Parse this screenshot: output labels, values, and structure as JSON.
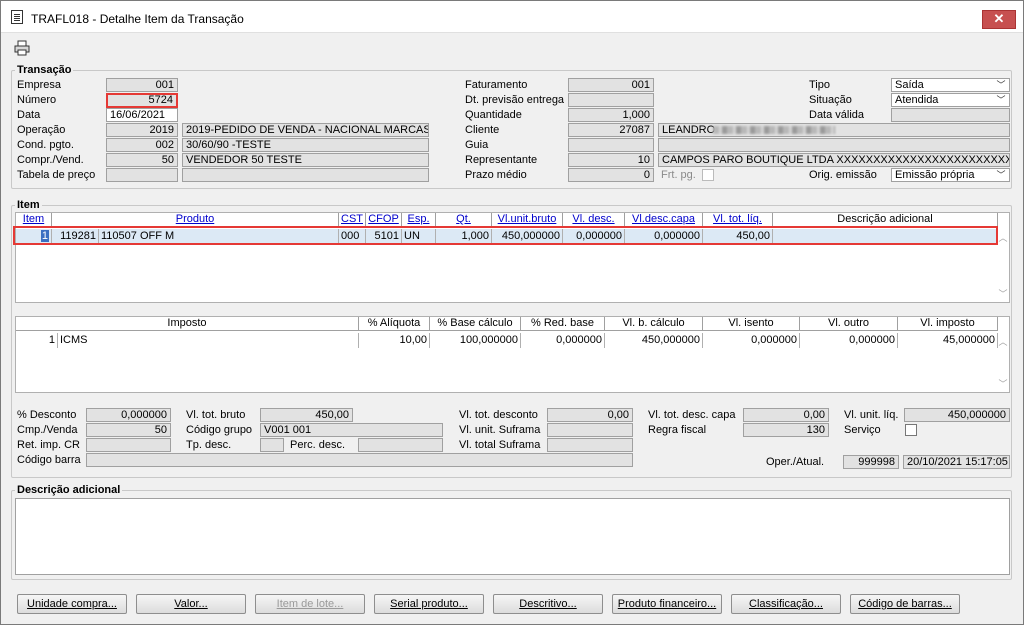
{
  "window": {
    "title": "TRAFL018 - Detalhe Item da Transação",
    "close": "✕"
  },
  "transacao": {
    "title": "Transação",
    "empresa_label": "Empresa",
    "empresa": "001",
    "numero_label": "Número",
    "numero": "5724",
    "data_label": "Data",
    "data": "16/06/2021",
    "operacao_label": "Operação",
    "operacao_code": "2019",
    "operacao_desc": "2019-PEDIDO DE VENDA - NACIONAL MARCAS",
    "cond_label": "Cond. pgto.",
    "cond_code": "002",
    "cond_desc": "30/60/90 -TESTE",
    "compr_label": "Compr./Vend.",
    "compr_code": "50",
    "compr_desc": "VENDEDOR 50 TESTE",
    "tabela_label": "Tabela de preço",
    "tabela_code": "",
    "tabela_desc": "",
    "faturamento_label": "Faturamento",
    "faturamento": "001",
    "dtprev_label": "Dt. previsão entrega",
    "dtprev": "",
    "quantidade_label": "Quantidade",
    "quantidade": "1,000",
    "cliente_label": "Cliente",
    "cliente_code": "27087",
    "cliente_name": "LEANDRO",
    "guia_label": "Guia",
    "guia": "",
    "representante_label": "Representante",
    "representante_code": "10",
    "representante_name": "CAMPOS PARO BOUTIQUE LTDA XXXXXXXXXXXXXXXXXXXXXXXXXXXX",
    "prazo_label": "Prazo médio",
    "prazo": "0",
    "frt_label": "Frt. pg.",
    "tipo_label": "Tipo",
    "tipo": "Saída",
    "situacao_label": "Situação",
    "situacao": "Atendida",
    "datavalida_label": "Data válida",
    "datavalida": "",
    "orig_label": "Orig. emissão",
    "orig": "Emissão própria"
  },
  "item": {
    "title": "Item",
    "headers": [
      "Item",
      "Produto",
      "CST",
      "CFOP",
      "Esp.",
      "Qt.",
      "Vl.unit.bruto",
      "Vl. desc.",
      "Vl.desc.capa",
      "Vl. tot. líq.",
      "Descrição adicional"
    ],
    "rows": [
      {
        "item": "1",
        "prod_code": "119281",
        "prod_name": "110507 OFF M",
        "cst": "000",
        "cfop": "5101",
        "esp": "UN",
        "qt": "1,000",
        "unit": "450,000000",
        "desc": "0,000000",
        "desccapa": "0,000000",
        "tot": "450,00",
        "descad": ""
      }
    ]
  },
  "impostos": {
    "headers": [
      "Imposto",
      "% Alíquota",
      "% Base cálculo",
      "% Red. base",
      "Vl. b. cálculo",
      "Vl. isento",
      "Vl. outro",
      "Vl. imposto"
    ],
    "rows": [
      {
        "n": "1",
        "imposto": "ICMS",
        "aliq": "10,00",
        "base": "100,000000",
        "red": "0,000000",
        "bcalc": "450,000000",
        "isento": "0,000000",
        "outro": "0,000000",
        "vimposto": "45,000000"
      }
    ]
  },
  "totais": {
    "pdesc_label": "% Desconto",
    "pdesc": "0,000000",
    "cmp_label": "Cmp./Venda",
    "cmp": "50",
    "retimp_label": "Ret. imp. CR",
    "retimp": "",
    "codbarra_label": "Código barra",
    "codbarra": "",
    "vltotbruto_label": "Vl. tot. bruto",
    "vltotbruto": "450,00",
    "codgrupo_label": "Código grupo",
    "codgrupo": "V001 001",
    "tpdesc_label": "Tp. desc.",
    "tpdesc": "",
    "percdesc_label": "Perc. desc.",
    "percdesc": "",
    "vltotdesc_label": "Vl. tot. desconto",
    "vltotdesc": "0,00",
    "vlunitsuf_label": "Vl. unit. Suframa",
    "vlunitsuf": "",
    "vltotsuf_label": "Vl. total Suframa",
    "vltotsuf": "",
    "vltotdesccapa_label": "Vl. tot. desc. capa",
    "vltotdesccapa": "0,00",
    "regra_label": "Regra fiscal",
    "regra": "130",
    "vlunitliq_label": "Vl. unit. líq.",
    "vlunitliq": "450,000000",
    "servico_label": "Serviço",
    "oper_label": "Oper./Atual.",
    "oper": "999998",
    "atual": "20/10/2021 15:17:05"
  },
  "descadicional": {
    "title": "Descrição adicional",
    "text": ""
  },
  "buttons": [
    "Unidade compra...",
    "Valor...",
    "Item de lote...",
    "Serial produto...",
    "Descritivo...",
    "Produto financeiro...",
    "Classificação...",
    "Código de barras..."
  ]
}
